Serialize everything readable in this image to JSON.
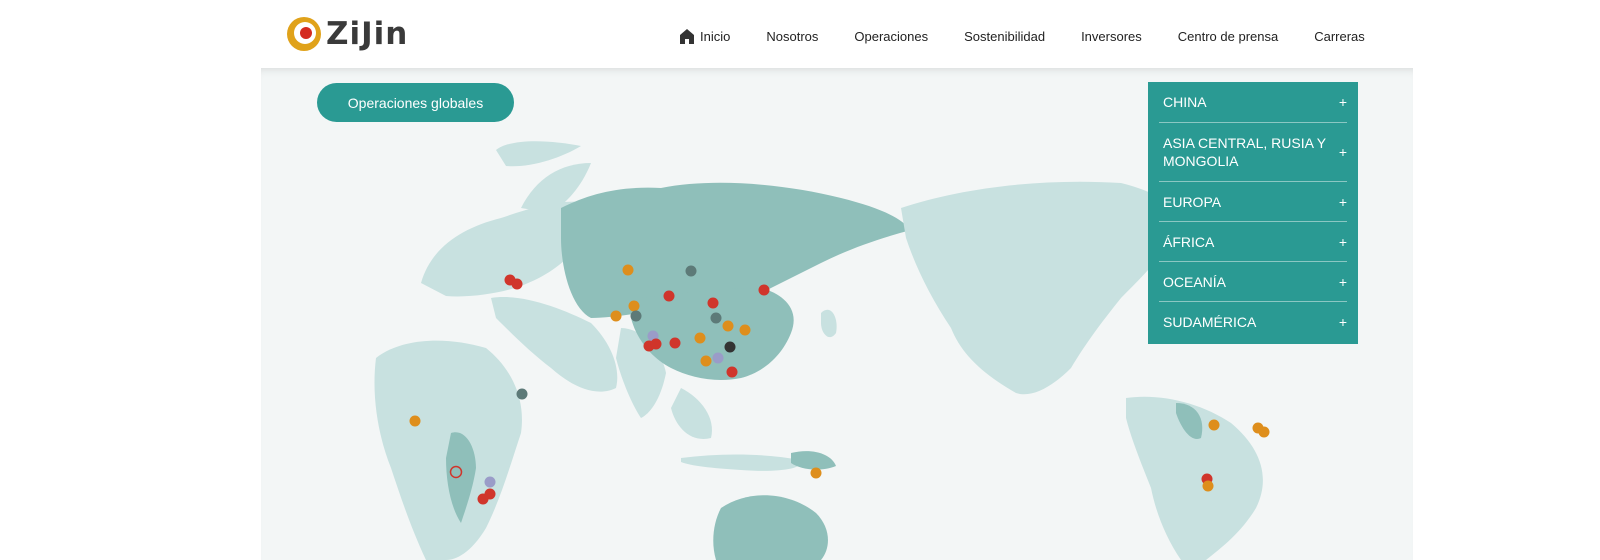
{
  "brand": {
    "logo_text": "ZiJin"
  },
  "nav": {
    "items": [
      {
        "label": "Inicio",
        "icon": "home-icon"
      },
      {
        "label": "Nosotros"
      },
      {
        "label": "Operaciones"
      },
      {
        "label": "Sostenibilidad"
      },
      {
        "label": "Inversores"
      },
      {
        "label": "Centro de prensa"
      },
      {
        "label": "Carreras"
      }
    ]
  },
  "map": {
    "global_button_label": "Operaciones globales",
    "regions": [
      {
        "label": "CHINA",
        "toggle": "+"
      },
      {
        "label": "ASIA CENTRAL, RUSIA Y MONGOLIA",
        "toggle": "+"
      },
      {
        "label": "EUROPA",
        "toggle": "+"
      },
      {
        "label": "ÁFRICA",
        "toggle": "+"
      },
      {
        "label": "OCEANÍA",
        "toggle": "+"
      },
      {
        "label": "SUDAMÉRICA",
        "toggle": "+"
      }
    ]
  },
  "colors": {
    "accent": "#2a9a93",
    "land_light": "#c8e1e0",
    "land_highlight": "#8fbfba",
    "ocean": "#f3f6f6",
    "marker_red": "#d0352b",
    "marker_orange": "#de8e1c",
    "marker_gray": "#5d7a78",
    "marker_lavender": "#9a9cc8",
    "marker_black": "#333333"
  }
}
